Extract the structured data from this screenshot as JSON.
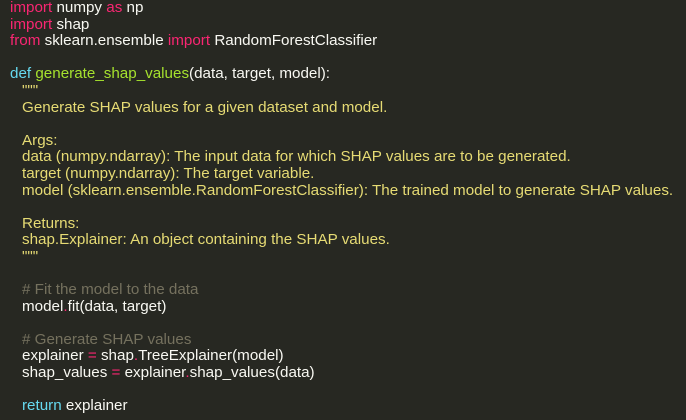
{
  "code": {
    "l1": {
      "kw_import": "import",
      "mod": "numpy",
      "kw_as": "as",
      "alias": "np"
    },
    "l2": {
      "kw_import": "import",
      "mod": "shap"
    },
    "l3": {
      "kw_from": "from",
      "mod": "sklearn.ensemble",
      "kw_import": "import",
      "name": "RandomForestClassifier"
    },
    "l5": {
      "kw_def": "def",
      "fname": "generate_shap_values",
      "params": "(data, target, model):"
    },
    "l6": {
      "text": "\"\"\""
    },
    "l7": {
      "text": "Generate SHAP values for a given dataset and model."
    },
    "l9": {
      "text": "Args:"
    },
    "l10": {
      "text": "data (numpy.ndarray): The input data for which SHAP values are to be generated."
    },
    "l11": {
      "text": "target (numpy.ndarray): The target variable."
    },
    "l12": {
      "text": "model (sklearn.ensemble.RandomForestClassifier): The trained model to generate SHAP values."
    },
    "l14": {
      "text": "Returns:"
    },
    "l15": {
      "text": "shap.Explainer: An object containing the SHAP values."
    },
    "l16": {
      "text": "\"\"\""
    },
    "l18": {
      "text": "# Fit the model to the data"
    },
    "l19": {
      "obj": "model",
      "dot": ".",
      "method": "fit",
      "args": "(data, target)"
    },
    "l21": {
      "text": "# Generate SHAP values"
    },
    "l22": {
      "lhs": "explainer",
      "eq": " = ",
      "obj": "shap",
      "dot": ".",
      "method": "TreeExplainer",
      "args": "(model)"
    },
    "l23": {
      "lhs": "shap_values",
      "eq": " = ",
      "obj": "explainer",
      "dot": ".",
      "method": "shap_values",
      "args": "(data)"
    },
    "l25": {
      "kw_return": "return",
      "value": " explainer"
    }
  },
  "colors": {
    "background": "#272822",
    "keyword": "#f92672",
    "keyword_def": "#66d9ef",
    "function": "#a6e22e",
    "string": "#e6db74",
    "comment": "#75715e",
    "text": "#f8f8f2"
  }
}
